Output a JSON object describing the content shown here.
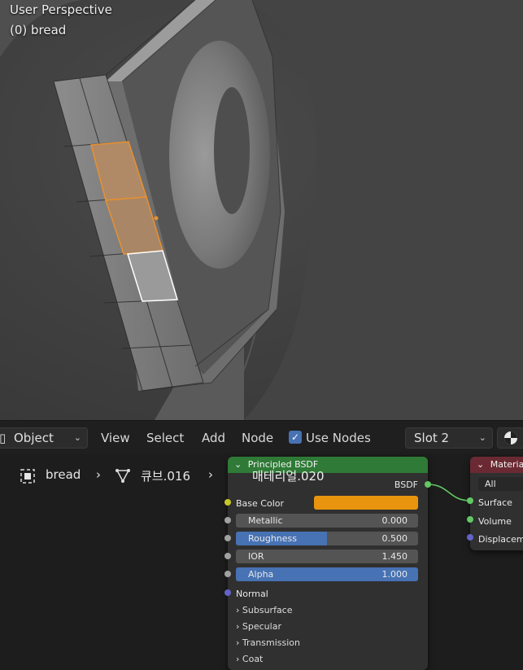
{
  "viewport": {
    "title": "User Perspective",
    "object_info": "(0) bread"
  },
  "header": {
    "mode": "Object",
    "menus": [
      "View",
      "Select",
      "Add",
      "Node"
    ],
    "use_nodes_label": "Use Nodes",
    "use_nodes_checked": true,
    "slot": "Slot 2"
  },
  "breadcrumb": {
    "object": "bread",
    "mesh": "큐브.016",
    "material": "매테리얼.020"
  },
  "principled": {
    "title": "Principled BSDF",
    "output": "BSDF",
    "base_color_label": "Base Color",
    "base_color": "#e8940f",
    "fields": [
      {
        "name": "Metallic",
        "value": "0.000",
        "fill": 0.0
      },
      {
        "name": "Roughness",
        "value": "0.500",
        "fill": 0.5
      },
      {
        "name": "IOR",
        "value": "1.450",
        "fill": 0.0
      },
      {
        "name": "Alpha",
        "value": "1.000",
        "fill": 1.0
      }
    ],
    "normal_label": "Normal",
    "subpanels": [
      "Subsurface",
      "Specular",
      "Transmission",
      "Coat"
    ]
  },
  "material_output": {
    "title": "Materia",
    "target": "All",
    "inputs": [
      "Surface",
      "Volume",
      "Displacem"
    ]
  },
  "colors": {
    "header_principled": "#2f7a36",
    "header_output": "#6b2a33",
    "socket_shader": "#63c763",
    "socket_color": "#c7c729",
    "socket_float": "#a1a1a1",
    "socket_vector": "#6363c7",
    "selected_face": "#e8902f",
    "accent": "#4772b3"
  }
}
